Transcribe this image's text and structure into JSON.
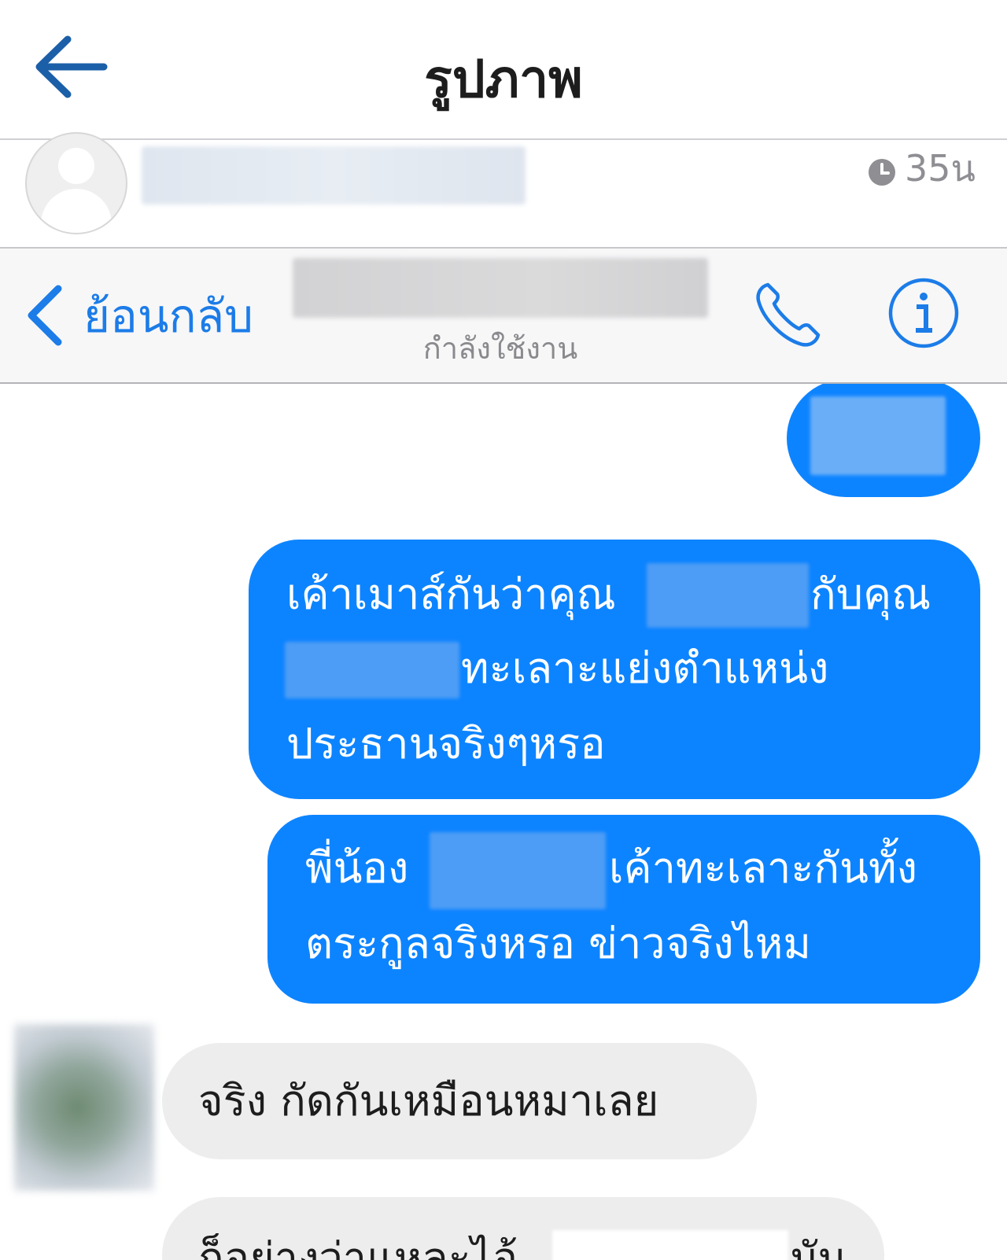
{
  "header": {
    "title": "รูปภาพ"
  },
  "post": {
    "time": "35น"
  },
  "nav": {
    "back_label": "ย้อนกลับ",
    "status": "กำลังใช้งาน"
  },
  "messages": {
    "out_2": {
      "line1_a": "เค้าเมาส์กันว่าคุณ",
      "line1_b": "กับคุณ",
      "line2": "ทะเลาะแย่งตำแหน่ง",
      "line3": "ประธานจริงๆหรอ"
    },
    "out_3": {
      "line1_a": "พี่น้อง",
      "line1_b": "เค้าทะเลาะกันทั้ง",
      "line2": "ตระกูลจริงหรอ ข่าวจริงไหม"
    },
    "in_1": {
      "text": "จริง กัดกันเหมือนหมาเลย"
    },
    "in_2": {
      "text_a": "ก็อย่างว่าแหละไอ้",
      "text_b": "มัน"
    }
  },
  "colors": {
    "accent": "#1c7ce8",
    "outgoing_bubble": "#0d84ff",
    "incoming_bubble": "#ededee"
  },
  "icons": {
    "top_back": "arrow-left-icon",
    "clock": "clock-icon",
    "nav_back": "chevron-left-icon",
    "phone": "phone-icon",
    "info": "info-icon"
  }
}
